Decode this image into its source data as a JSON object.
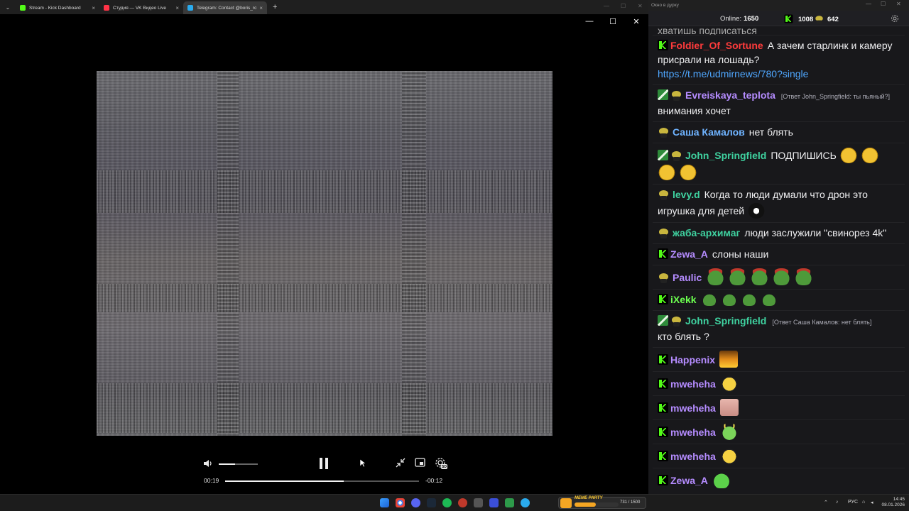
{
  "browser": {
    "tabs": [
      {
        "label": "Stream - Kick Dashboard",
        "icon": "kick-icon",
        "color": "#53fc18",
        "active": false
      },
      {
        "label": "Студия — VK Видео Live",
        "icon": "vk-video-icon",
        "color": "#ff3347",
        "active": false
      },
      {
        "label": "Telegram: Contact @boris_rozh",
        "icon": "telegram-icon",
        "color": "#2aabee",
        "active": true
      }
    ],
    "new_tab": "+",
    "tab_close": "×"
  },
  "player": {
    "window_buttons": {
      "minimize": "—",
      "maximize": "☐",
      "close": "✕"
    },
    "volume_level": 0.42,
    "progress": 0.61,
    "time_elapsed": "00:19",
    "time_remaining": "-00:12",
    "quality_badge": "SD"
  },
  "chat": {
    "window_title": "Окно в дурку",
    "online_label": "Online:",
    "online_count": "1650",
    "kick_count": "1008",
    "vk_count": "642",
    "partial_message": "хватишь подписаться",
    "messages": [
      {
        "badges": [
          "kick"
        ],
        "user": "Foldier_Of_Sortune",
        "color": "#ff3b3b",
        "text": "А зачем старлинк и камеру присрали на лошадь?",
        "link": "https://t.me/udmirnews/780?single"
      },
      {
        "badges": [
          "sub",
          "pepe"
        ],
        "user": "Evreiskaya_teplota",
        "color": "#b58cff",
        "reply": "[Ответ John_Springfield: ты пьяный?]",
        "text": "внимания хочет"
      },
      {
        "badges": [
          "pepe"
        ],
        "user": "Саша Камалов",
        "color": "#6fb3ff",
        "text": "нет блять"
      },
      {
        "badges": [
          "sub",
          "pepe"
        ],
        "user": "John_Springfield",
        "color": "#3fd2a0",
        "text": "ПОДПИШИСЬ",
        "emotes": [
          "laugh",
          "laugh",
          "laugh",
          "laugh"
        ]
      },
      {
        "badges": [
          "pepe"
        ],
        "user": "levy.d",
        "color": "#3fd2a0",
        "text": "Когда то люди думали что дрон это игрушка для детей",
        "emotes": [
          "cat"
        ]
      },
      {
        "badges": [
          "pepe"
        ],
        "user": "жаба-архимаг",
        "color": "#3fd2a0",
        "text": "люди заслужили \"свинорез 4k\""
      },
      {
        "badges": [
          "kick"
        ],
        "user": "Zewa_A",
        "color": "#b58cff",
        "text": "слоны наши"
      },
      {
        "badges": [
          "pepe"
        ],
        "user": "Paulic",
        "color": "#b58cff",
        "text": "",
        "emotes": [
          "pepe",
          "pepe",
          "pepe",
          "pepe",
          "pepe"
        ]
      },
      {
        "badges": [
          "kick"
        ],
        "user": "iXekk",
        "color": "#6cff4f",
        "text": "",
        "emotes": [
          "pepe-s",
          "pepe-s",
          "pepe-s",
          "pepe-s"
        ]
      },
      {
        "badges": [
          "sub",
          "pepe"
        ],
        "user": "John_Springfield",
        "color": "#3fd2a0",
        "reply": "[Ответ Саша Камалов: нет блять]",
        "text": "кто блять ?"
      },
      {
        "badges": [
          "kick"
        ],
        "user": "Happenix",
        "color": "#b58cff",
        "text": "",
        "emotes": [
          "fire"
        ]
      },
      {
        "badges": [
          "kick"
        ],
        "user": "mweheha",
        "color": "#b58cff",
        "text": "",
        "emotes": [
          "bee"
        ]
      },
      {
        "badges": [
          "kick"
        ],
        "user": "mweheha",
        "color": "#b58cff",
        "text": "",
        "emotes": [
          "face"
        ]
      },
      {
        "badges": [
          "kick"
        ],
        "user": "mweheha",
        "color": "#b58cff",
        "text": "",
        "emotes": [
          "halo"
        ]
      },
      {
        "badges": [
          "kick"
        ],
        "user": "mweheha",
        "color": "#b58cff",
        "text": "",
        "emotes": [
          "bee"
        ]
      },
      {
        "badges": [
          "kick"
        ],
        "user": "Zewa_A",
        "color": "#b58cff",
        "text": "",
        "emotes": [
          "frog"
        ]
      }
    ]
  },
  "taskbar": {
    "widget_label": "MEME PARTY",
    "widget_count": "731 / 1500",
    "widget_progress": 0.49,
    "lang": "РУС",
    "time": "14:45",
    "date": "08.01.2026"
  }
}
